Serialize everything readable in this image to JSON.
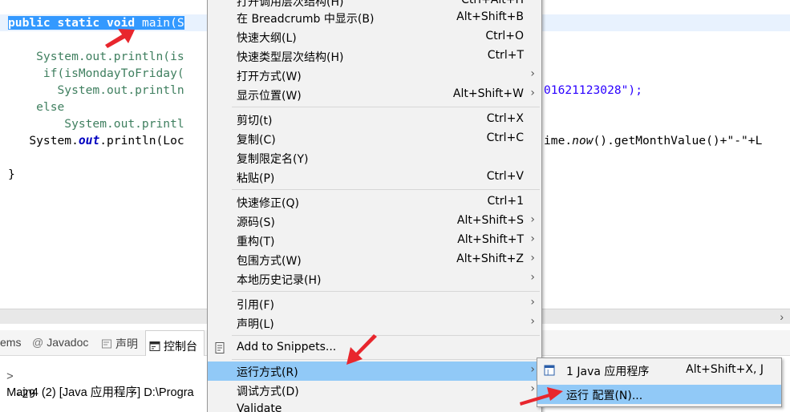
{
  "editor": {
    "lines": {
      "l1": {
        "kw": "public static void",
        "rest_sel": " main(S"
      },
      "l2": {
        "text": "    System.out.println(is"
      },
      "l3": {
        "text": "     if(isMondayToFriday("
      },
      "l4": {
        "text": "       System.out.println",
        "tail": "01621123028\");"
      },
      "l5": {
        "text": "    else"
      },
      "l6": {
        "text": "        System.out.printl"
      },
      "l7": {
        "indent": "   System.",
        "out": "out",
        "mid": ".println(Loc",
        "tail_pre": "ime.",
        "tail_now": "now",
        "tail_post": "().getMonthValue()+\"-\"+L"
      },
      "l8": {
        "text": "}"
      }
    }
  },
  "panel": {
    "tabs": {
      "problems": "ems",
      "javadoc": "Javadoc",
      "declaration": "声明",
      "console": "控制台"
    },
    "console": {
      "title": "Main4 (2) [Java 应用程序] D:\\Progra",
      "output": "-29"
    }
  },
  "menu": {
    "top_cut": "打开调用层次结构(H)",
    "top_cut_sc": "Ctrl+Alt+H",
    "items": [
      {
        "label": "在 Breadcrumb 中显示(B)",
        "shortcut": "Alt+Shift+B"
      },
      {
        "label": "快速大纲(L)",
        "shortcut": "Ctrl+O"
      },
      {
        "label": "快速类型层次结构(H)",
        "shortcut": "Ctrl+T"
      },
      {
        "label": "打开方式(W)",
        "shortcut": ""
      },
      {
        "label": "显示位置(W)",
        "shortcut": "Alt+Shift+W"
      },
      {
        "label": "剪切(t)",
        "shortcut": "Ctrl+X"
      },
      {
        "label": "复制(C)",
        "shortcut": "Ctrl+C"
      },
      {
        "label": "复制限定名(Y)",
        "shortcut": ""
      },
      {
        "label": "粘贴(P)",
        "shortcut": "Ctrl+V"
      },
      {
        "label": "快速修正(Q)",
        "shortcut": "Ctrl+1"
      },
      {
        "label": "源码(S)",
        "shortcut": "Alt+Shift+S"
      },
      {
        "label": "重构(T)",
        "shortcut": "Alt+Shift+T"
      },
      {
        "label": "包围方式(W)",
        "shortcut": "Alt+Shift+Z"
      },
      {
        "label": "本地历史记录(H)",
        "shortcut": ""
      },
      {
        "label": "引用(F)",
        "shortcut": ""
      },
      {
        "label": "声明(L)",
        "shortcut": ""
      },
      {
        "label": "Add to Snippets...",
        "shortcut": ""
      },
      {
        "label": "运行方式(R)",
        "shortcut": ""
      },
      {
        "label": "调试方式(D)",
        "shortcut": ""
      },
      {
        "label": "Validate",
        "shortcut": ""
      }
    ]
  },
  "submenu": {
    "items": [
      {
        "label": "1 Java 应用程序",
        "shortcut": "Alt+Shift+X, J"
      },
      {
        "label": "运行 配置(N)...",
        "shortcut": ""
      }
    ]
  },
  "colors": {
    "selection": "#3399ff",
    "menu_highlight": "#91c9f7",
    "annotation_arrow": "#e8262d",
    "keyword": "#7f0055"
  }
}
